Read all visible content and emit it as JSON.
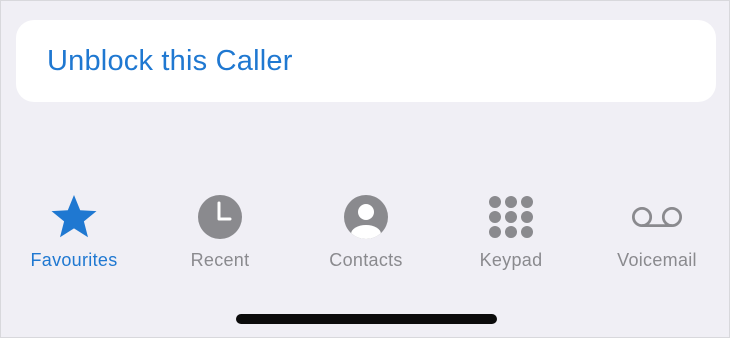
{
  "card": {
    "action_label": "Unblock this Caller"
  },
  "tabbar": {
    "tabs": [
      {
        "label": "Favourites",
        "icon": "star-icon",
        "active": true
      },
      {
        "label": "Recent",
        "icon": "clock-icon",
        "active": false
      },
      {
        "label": "Contacts",
        "icon": "person-circle-icon",
        "active": false
      },
      {
        "label": "Keypad",
        "icon": "keypad-icon",
        "active": false
      },
      {
        "label": "Voicemail",
        "icon": "voicemail-icon",
        "active": false
      }
    ]
  },
  "colors": {
    "accent": "#1f78d1",
    "inactive": "#8a8a8e",
    "background": "#f0eff5"
  }
}
